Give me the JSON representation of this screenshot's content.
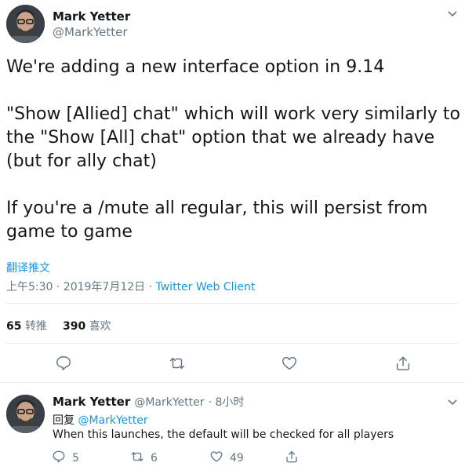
{
  "main_tweet": {
    "author_name": "Mark Yetter",
    "author_handle": "@MarkYetter",
    "text": "We're adding a new interface option in 9.14\n\n\"Show [Allied] chat\" which will work very similarly to the \"Show [All] chat\" option that we already have (but for ally chat)\n\nIf you're a /mute all regular, this will persist from game to game",
    "translate_label": "翻译推文",
    "timestamp": "上午5:30 · 2019年7月12日",
    "separator": " · ",
    "client": "Twitter Web Client",
    "retweets_count": "65",
    "retweets_label": "转推",
    "likes_count": "390",
    "likes_label": "喜欢"
  },
  "reply": {
    "author_name": "Mark Yetter",
    "author_handle": "@MarkYetter",
    "time": "· 8小时",
    "reply_prefix": "回复",
    "reply_to": "@MarkYetter",
    "text": "When this launches, the default will be checked for all players",
    "reply_count": "5",
    "retweet_count": "6",
    "like_count": "49"
  },
  "icons": {
    "caret": "chevron-down",
    "reply": "comment",
    "retweet": "retweet",
    "like": "heart",
    "share": "share-up"
  },
  "colors": {
    "link": "#1b95e0",
    "muted": "#657786",
    "divider": "#e6ecf0"
  }
}
